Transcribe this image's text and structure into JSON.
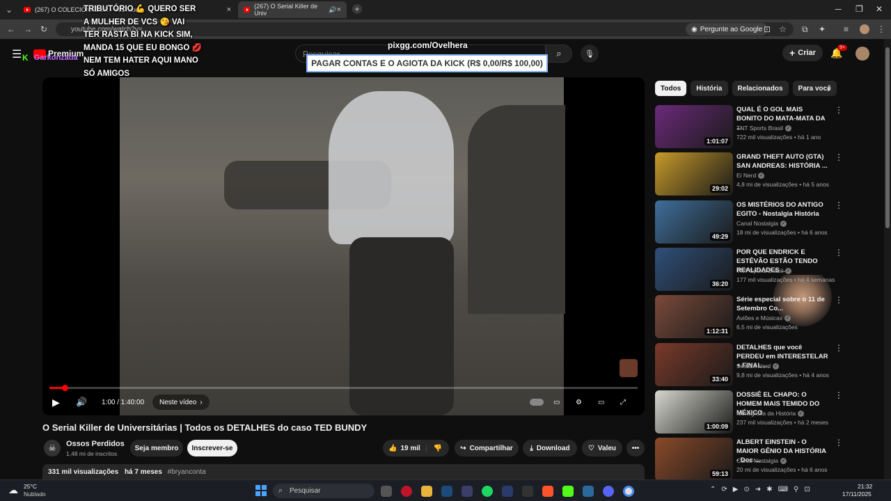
{
  "browser": {
    "tabs": [
      {
        "title": "(267) O COLECIONADOR - YouTube",
        "close": "×"
      },
      {
        "title": "(267) O Serial Killer de Univ",
        "close": "×"
      }
    ],
    "address": "youtube.com/watch?v=...",
    "ask_google": "Pergunte ao Google"
  },
  "youtube": {
    "logo": "Premium",
    "search_placeholder": "Pesquisar",
    "create_label": "Criar",
    "notif_count": "9+"
  },
  "overlays": {
    "streamer": "Garkonzada",
    "tts": "TRIBUTÓRIO 💪 QUERO SER A MULHER DE VCS 😘 VAI TER RASTA BI NA KICK SIM, MANDA 15 QUE EU BONGO 💋 NEM TEM HATER AQUI MANO SÓ AMIGOS",
    "site": "pixgg.com/Ovelhera",
    "goal": "PAGAR CONTAS E O AGIOTA DA KICK (R$ 0,00/R$ 100,00)"
  },
  "player": {
    "time": "1:00 / 1:40:00",
    "chapter": "Neste vídeo",
    "progress": 0.01
  },
  "video": {
    "title": "O Serial Killer de Universitárias | Todos os DETALHES do caso TED BUNDY",
    "channel": "Ossos Perdidos",
    "subs": "1,48 mi de inscritos",
    "member": "Seja membro",
    "subscribe": "Inscrever-se",
    "likes": "19 mil",
    "share": "Compartilhar",
    "download": "Download",
    "thanks": "Valeu",
    "views": "331 mil visualizações",
    "age": "há 7 meses",
    "hashtag": "#bryanconta"
  },
  "chips": [
    "Todos",
    "História",
    "Relacionados",
    "Para você"
  ],
  "recs": [
    {
      "title": "QUAL É O GOL MAIS BONITO DO MATA-MATA DA ...",
      "channel": "TNT Sports Brasil",
      "meta": "722 mil visualizações • há 1 ano",
      "dur": "1:01:07",
      "color": "#6b2a7a"
    },
    {
      "title": "GRAND THEFT AUTO (GTA) SAN ANDREAS: HISTÓRIA ...",
      "channel": "Ei Nerd",
      "meta": "4,8 mi de visualizações • há 5 anos",
      "dur": "29:02",
      "color": "#c79a2a"
    },
    {
      "title": "OS MISTÉRIOS DO ANTIGO EGITO - Nostalgia História",
      "channel": "Canal Nostalgia",
      "meta": "18 mi de visualizações • há 6 anos",
      "dur": "49:29",
      "color": "#3f6f9a"
    },
    {
      "title": "POR QUE ENDRICK E ESTÊVÃO ESTÃO TENDO REALIDADES ...",
      "channel": "TNT Sports Brasil",
      "meta": "177 mil visualizações • há 4 semanas",
      "dur": "36:20",
      "color": "#2f4f7a"
    },
    {
      "title": "Série especial sobre o 11 de Setembro Co...",
      "channel": "Aviões e Músicas",
      "meta": "6,5 mi de visualizações",
      "dur": "1:12:31",
      "color": "#7a4a3a"
    },
    {
      "title": "DETALHES que você PERDEU em INTERESTELAR + FINAL ...",
      "channel": "Sessão Nerd",
      "meta": "9,8 mi de visualizações • há 4 anos",
      "dur": "33:40",
      "color": "#7a3a2a"
    },
    {
      "title": "DOSSIÊ EL CHAPO: O HOMEM MAIS TEMIDO DO MÉXICO",
      "channel": "Iconografia da História",
      "meta": "237 mil visualizações • há 2 meses",
      "dur": "1:00:09",
      "color": "#d8d8d0"
    },
    {
      "title": "ALBERT EINSTEIN - O MAIOR GÊNIO DA HISTÓRIA - Doc ...",
      "channel": "Canal Nostalgia",
      "meta": "20 mi de visualizações • há 6 anos",
      "dur": "59:13",
      "color": "#8a4a2a"
    }
  ],
  "taskbar": {
    "weather_temp": "25°C",
    "weather_desc": "Nublado",
    "search": "Pesquisar",
    "time": "21:32",
    "date": "17/11/2025"
  }
}
